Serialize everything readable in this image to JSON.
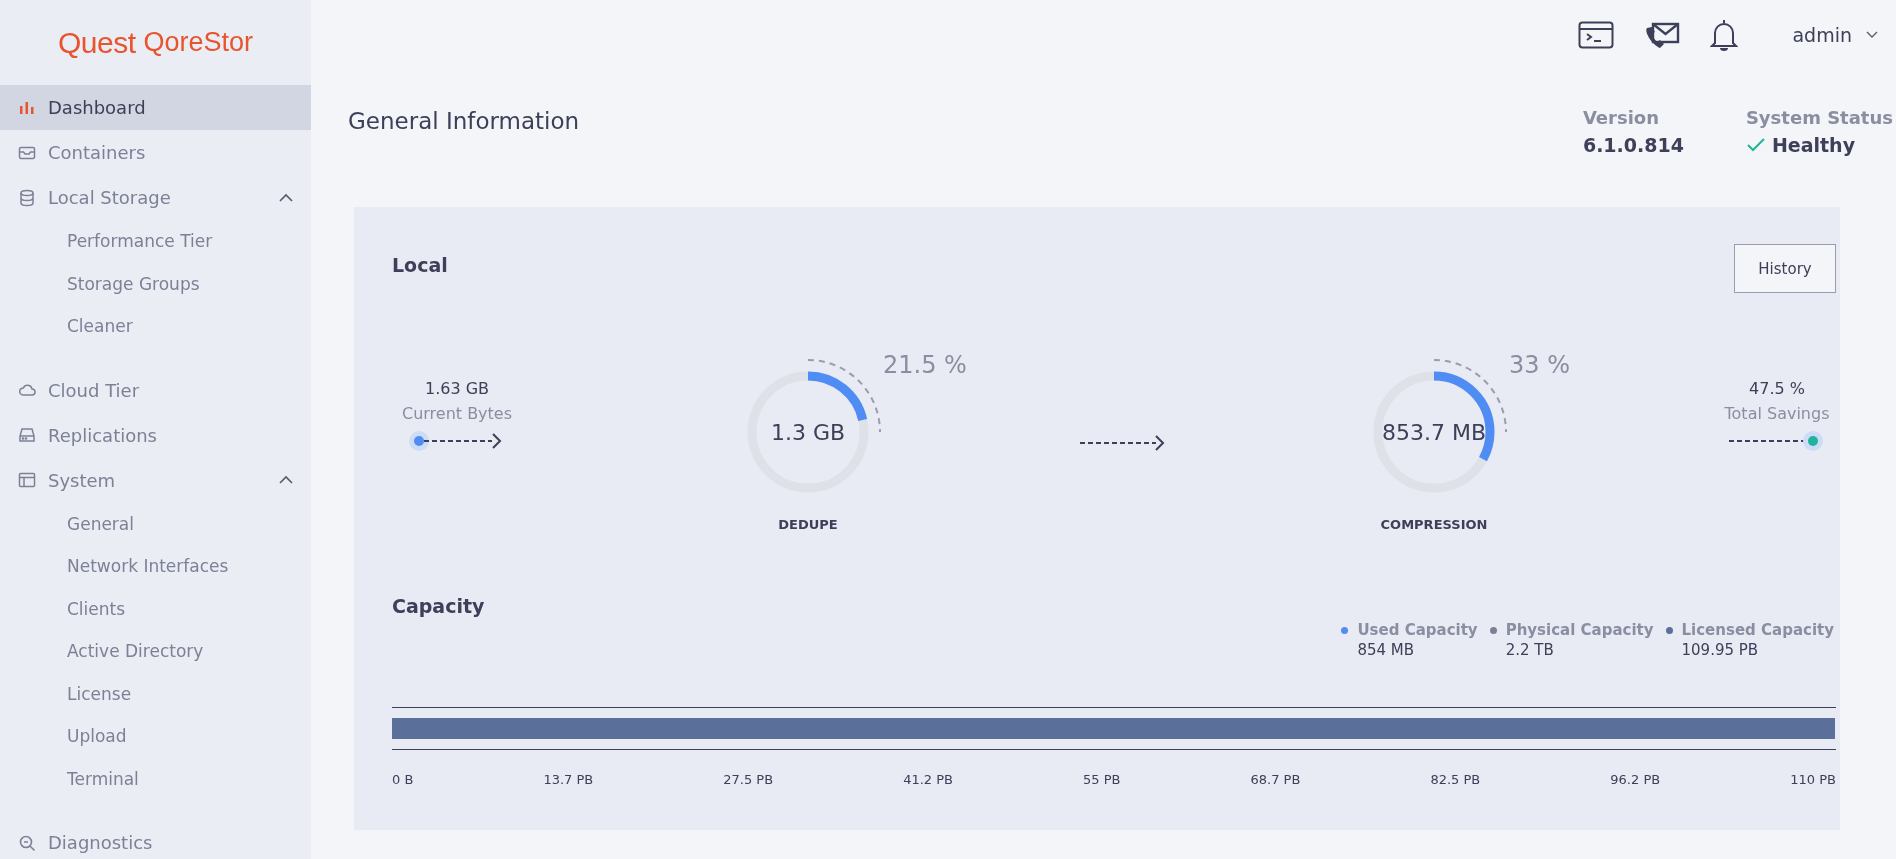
{
  "brand": {
    "mark": "Quest",
    "product": "QoreStor"
  },
  "sidebar": {
    "items": [
      {
        "label": "Dashboard",
        "selected": true
      },
      {
        "label": "Containers",
        "selected": false
      },
      {
        "label": "Local Storage",
        "selected": false,
        "expanded": true,
        "children": [
          {
            "label": "Performance Tier",
            "selected": false
          },
          {
            "label": "Storage Groups",
            "selected": false
          },
          {
            "label": "Cleaner",
            "selected": false
          }
        ]
      },
      {
        "label": "Cloud Tier",
        "selected": false
      },
      {
        "label": "Replications",
        "selected": false
      },
      {
        "label": "System",
        "selected": false,
        "expanded": true,
        "children": [
          {
            "label": "General",
            "selected": false
          },
          {
            "label": "Network Interfaces",
            "selected": false
          },
          {
            "label": "Clients",
            "selected": false
          },
          {
            "label": "Active Directory",
            "selected": false
          },
          {
            "label": "License",
            "selected": false
          },
          {
            "label": "Upload",
            "selected": false
          },
          {
            "label": "Terminal",
            "selected": false
          }
        ]
      },
      {
        "label": "Diagnostics",
        "selected": false
      }
    ]
  },
  "topbar": {
    "user": "admin"
  },
  "page": {
    "title": "General Information",
    "version_label": "Version",
    "version": "6.1.0.814",
    "status_label": "System Status",
    "status": "Healthy"
  },
  "local": {
    "title": "Local",
    "history_button": "History",
    "current": {
      "value": "1.63 GB",
      "label": "Current Bytes"
    },
    "dedupe": {
      "value": "1.3 GB",
      "label": "DEDUPE",
      "percent": "21.5 %",
      "level": 0.215
    },
    "compression": {
      "value": "853.7 MB",
      "label": "COMPRESSION",
      "percent": "33 %",
      "level": 0.33
    },
    "savings": {
      "value": "47.5 %",
      "label": "Total Savings"
    }
  },
  "capacity": {
    "title": "Capacity",
    "legend": [
      {
        "label": "Used Capacity",
        "value": "854 MB",
        "color": "#4f8df5"
      },
      {
        "label": "Physical Capacity",
        "value": "2.2 TB",
        "color": "#7c7f96"
      },
      {
        "label": "Licensed Capacity",
        "value": "109.95 PB",
        "color": "#5a6f99"
      }
    ],
    "bar": {
      "level": 0.9995
    },
    "scale": [
      "0 B",
      "13.7 PB",
      "27.5 PB",
      "41.2 PB",
      "55 PB",
      "68.7 PB",
      "82.5 PB",
      "96.2 PB",
      "110 PB"
    ]
  }
}
